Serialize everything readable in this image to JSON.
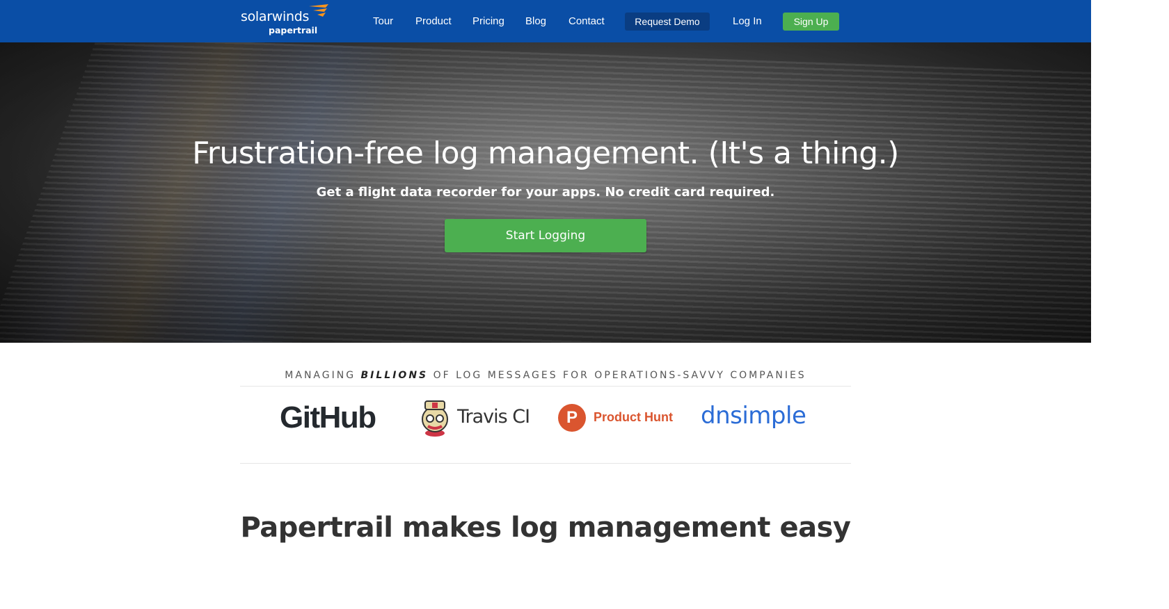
{
  "nav": {
    "logo_brand": "solarwinds",
    "logo_product": "papertrail",
    "links": [
      "Tour",
      "Product",
      "Pricing",
      "Blog",
      "Contact"
    ],
    "request_demo": "Request Demo",
    "log_in": "Log In",
    "sign_up": "Sign Up"
  },
  "hero": {
    "title": "Frustration-free log management. (It's a thing.)",
    "subtitle": "Get a flight data recorder for your apps. No credit card required.",
    "cta": "Start Logging"
  },
  "customers": {
    "tagline_pre": "Managing ",
    "tagline_em": "Billions",
    "tagline_post": " of log messages for operations-savvy companies",
    "logos": [
      "GitHub",
      "Travis CI",
      "Product Hunt",
      "dnsimple"
    ],
    "product_hunt_letter": "P"
  },
  "section": {
    "title": "Papertrail makes log management easy"
  },
  "colors": {
    "nav_bg": "#0a4ea6",
    "demo_bg": "#0a3d82",
    "green": "#4caf50",
    "product_hunt": "#da552f",
    "dnsimple": "#2b6cd6"
  }
}
